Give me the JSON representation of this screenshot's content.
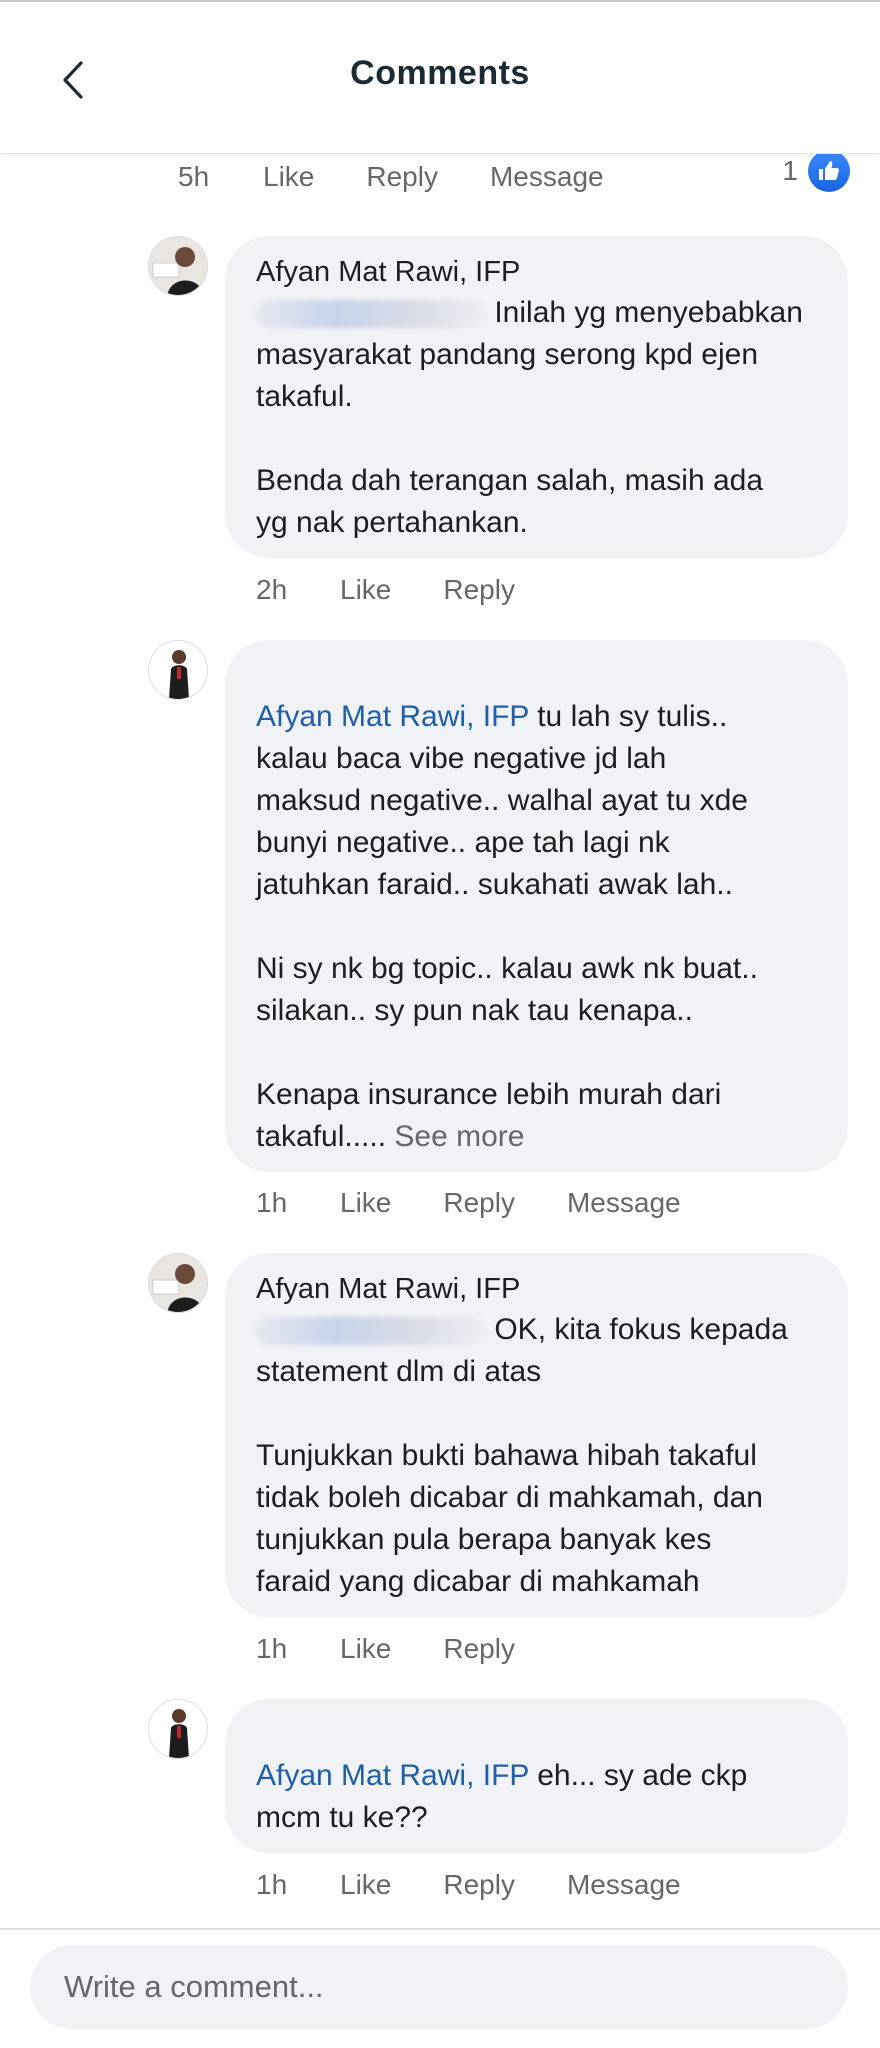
{
  "header": {
    "title": "Comments",
    "back_icon": "chevron-left-icon"
  },
  "top_meta": {
    "time": "5h",
    "like": "Like",
    "reply": "Reply",
    "message": "Message",
    "reaction_count": "1",
    "reaction_icon": "thumbs-up-icon"
  },
  "comments": [
    {
      "author": "Afyan Mat Rawi, IFP",
      "line1_suffix": "Inilah yg menyebabkan",
      "body": "masyarakat pandang serong kpd ejen\ntakaful.\n\nBenda dah terangan salah, masih ada\nyg nak pertahankan.",
      "time": "2h",
      "like": "Like",
      "reply": "Reply"
    },
    {
      "mention": "Afyan Mat Rawi, IFP",
      "line1_suffix": " tu lah sy tulis..",
      "body": "kalau baca vibe negative jd lah\nmaksud negative.. walhal ayat tu xde\nbunyi negative.. ape tah lagi nk\njatuhkan faraid.. sukahati awak lah..\n\nNi sy nk bg topic.. kalau awk nk buat..\nsilakan.. sy pun nak tau kenapa..\n\nKenapa insurance lebih murah dari\ntakaful.....",
      "see_more": "See more",
      "time": "1h",
      "like": "Like",
      "reply": "Reply",
      "message": "Message"
    },
    {
      "author": "Afyan Mat Rawi, IFP",
      "line1_suffix": "OK, kita fokus kepada",
      "body": "statement dlm di atas\n\nTunjukkan bukti bahawa hibah takaful\ntidak boleh dicabar di mahkamah, dan\ntunjukkan pula berapa banyak kes\nfaraid yang dicabar di mahkamah",
      "time": "1h",
      "like": "Like",
      "reply": "Reply"
    },
    {
      "mention": "Afyan Mat Rawi, IFP",
      "line1_suffix": " eh... sy ade ckp",
      "body": "mcm tu ke??",
      "time": "1h",
      "like": "Like",
      "reply": "Reply",
      "message": "Message"
    }
  ],
  "composer": {
    "placeholder": "Write a comment..."
  },
  "colors": {
    "mention": "#1f5ea8",
    "bubble": "#f0f2f5",
    "meta": "#65676b",
    "like_badge": "#1877f2"
  }
}
